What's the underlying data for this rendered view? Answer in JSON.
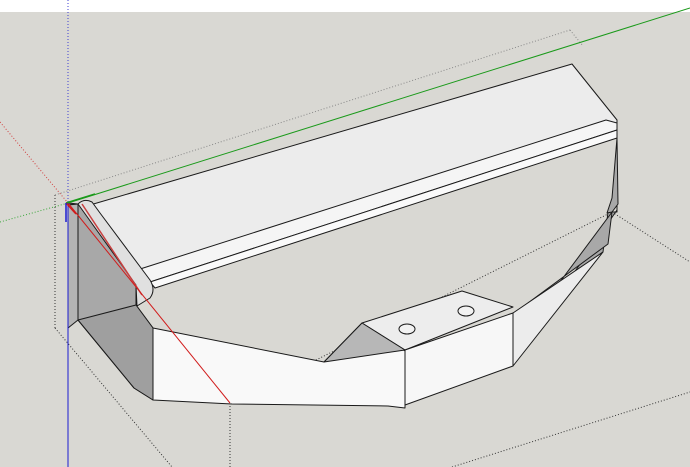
{
  "app": {
    "viewport_label": "",
    "background": {
      "sky": "#ffffff",
      "ground": "#d9d8d3"
    }
  },
  "axes": {
    "red": "#d11c1c",
    "green": "#1a9a1a",
    "blue": "#1b1bd1"
  },
  "model": {
    "name": "",
    "face_colors": {
      "top": "#ececec",
      "top_light": "#f6f6f6",
      "front_light": "#fbfbfb",
      "side_dark": "#a9a9a9",
      "side_mid": "#bdbdbd",
      "edge": "#1a1a1a"
    },
    "holes": 2
  }
}
